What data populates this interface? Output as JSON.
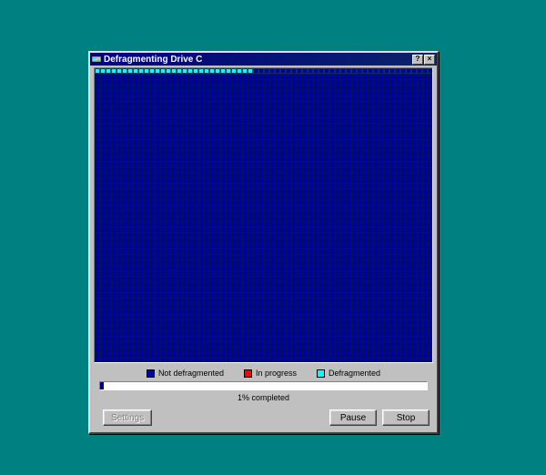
{
  "window": {
    "title": "Defragmenting Drive C",
    "icon": "disk-icon",
    "help_label": "?",
    "close_label": "×"
  },
  "drive_map": {
    "toprow_cells_total": 62,
    "toprow_defragmented_count": 29,
    "cell_states": {
      "defragmented": "defrag",
      "not_defragmented": "notdef"
    }
  },
  "legend": {
    "not_defragmented": "Not defragmented",
    "in_progress": "In progress",
    "defragmented": "Defragmented"
  },
  "progress": {
    "percent": 1,
    "label": "1% completed"
  },
  "buttons": {
    "settings": "Settings",
    "pause": "Pause",
    "stop": "Stop"
  },
  "colors": {
    "desktop": "#008080",
    "titlebar": "#000080",
    "not_defragmented": "#0000a0",
    "in_progress": "#ff0000",
    "defragmented": "#00ffff",
    "window_face": "#c0c0c0"
  }
}
